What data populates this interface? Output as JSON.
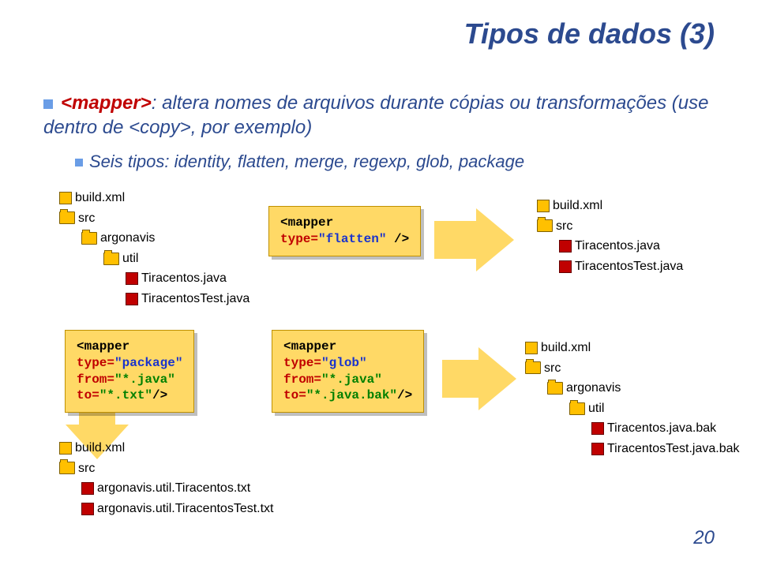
{
  "title": "Tipos de dados (3)",
  "bullet": {
    "tag": "<mapper>",
    "text": ": altera nomes de arquivos durante cópias ou transformações (use dentro de <copy>, por exemplo)"
  },
  "sub": "Seis tipos: identity, flatten, merge, regexp, glob, package",
  "tree1": {
    "f1": "build.xml",
    "d1": "src",
    "d2": "argonavis",
    "d3": "util",
    "f2": "Tiracentos.java",
    "f3": "TiracentosTest.java"
  },
  "code_flatten": {
    "l1": "<mapper",
    "l2": "   type=",
    "v2": "\"flatten\"",
    "e2": " />"
  },
  "tree2": {
    "f1": "build.xml",
    "d1": "src",
    "f2": "Tiracentos.java",
    "f3": "TiracentosTest.java"
  },
  "code_pkg": {
    "l1": "<mapper",
    "l2": "   type=",
    "v2": "\"package\"",
    "l3": "   from=",
    "v3": "\"*.java\"",
    "l4": "   to=",
    "v4": "\"*.txt\"",
    "e4": "/>"
  },
  "code_glob": {
    "l1": "<mapper",
    "l2": "   type=",
    "v2": "\"glob\"",
    "l3": "   from=",
    "v3": "\"*.java\"",
    "l4": "   to=",
    "v4": "\"*.java.bak\"",
    "e4": "/>"
  },
  "tree3": {
    "f1": "build.xml",
    "d1": "src",
    "f2": "argonavis.util.Tiracentos.txt",
    "f3": "argonavis.util.TiracentosTest.txt"
  },
  "tree4": {
    "f1": "build.xml",
    "d1": "src",
    "d2": "argonavis",
    "d3": "util",
    "f2": "Tiracentos.java.bak",
    "f3": "TiracentosTest.java.bak"
  },
  "page": "20"
}
